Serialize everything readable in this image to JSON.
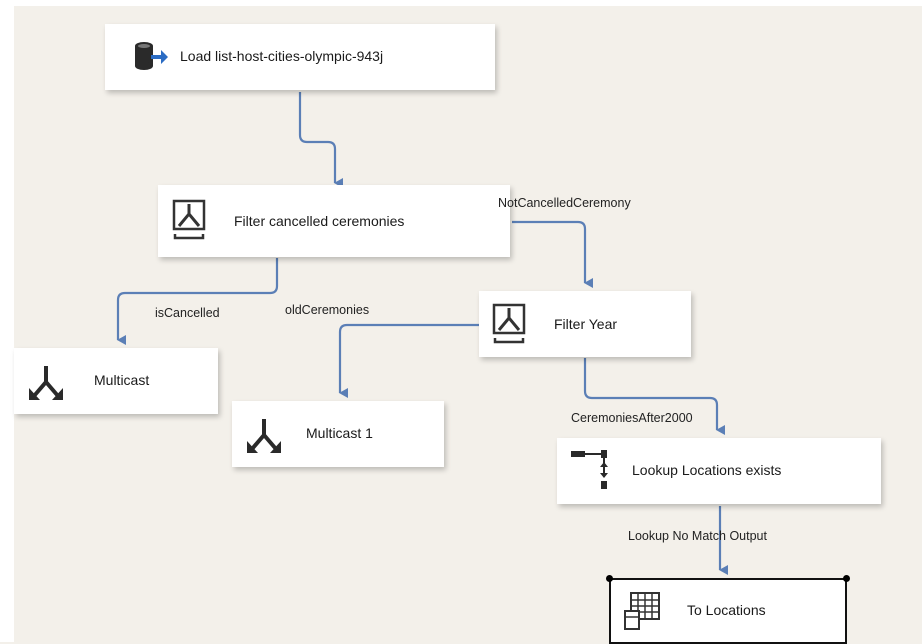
{
  "nodes": {
    "load": {
      "label": "Load list-host-cities-olympic-943j",
      "icon": "database-source-icon"
    },
    "filter_cancelled": {
      "label": "Filter cancelled ceremonies",
      "icon": "conditional-split-icon"
    },
    "filter_year": {
      "label": "Filter Year",
      "icon": "conditional-split-icon"
    },
    "multicast": {
      "label": "Multicast",
      "icon": "multicast-icon"
    },
    "multicast_1": {
      "label": "Multicast 1",
      "icon": "multicast-icon"
    },
    "lookup": {
      "label": "Lookup Locations exists",
      "icon": "lookup-icon"
    },
    "to_locations": {
      "label": "To Locations",
      "icon": "table-destination-icon"
    }
  },
  "paths": {
    "not_cancelled": "NotCancelledCeremony",
    "is_cancelled": "isCancelled",
    "old_ceremonies": "oldCeremonies",
    "after_2000": "CeremoniesAfter2000",
    "lookup_no_match": "Lookup No Match Output"
  },
  "colors": {
    "canvas": "#f3f0ea",
    "connector": "#5b7fb6",
    "node_bg": "#ffffff"
  }
}
